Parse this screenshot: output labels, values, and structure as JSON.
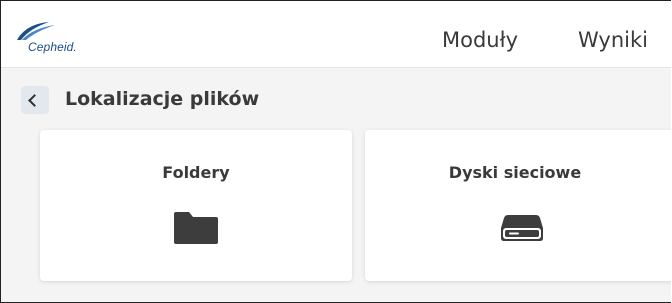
{
  "header": {
    "logo_text": "Cepheid.",
    "nav": [
      {
        "label": "Moduły"
      },
      {
        "label": "Wyniki"
      }
    ]
  },
  "page": {
    "title": "Lokalizacje plików",
    "back_icon": "chevron-left-icon"
  },
  "cards": [
    {
      "title": "Foldery",
      "icon": "folder-icon"
    },
    {
      "title": "Dyski sieciowe",
      "icon": "hard-drive-icon"
    }
  ],
  "colors": {
    "brand_blue": "#1b4f8a",
    "icon_dark": "#3d3d3d",
    "background": "#f4f4f4",
    "back_button_bg": "#e3e8ef"
  }
}
